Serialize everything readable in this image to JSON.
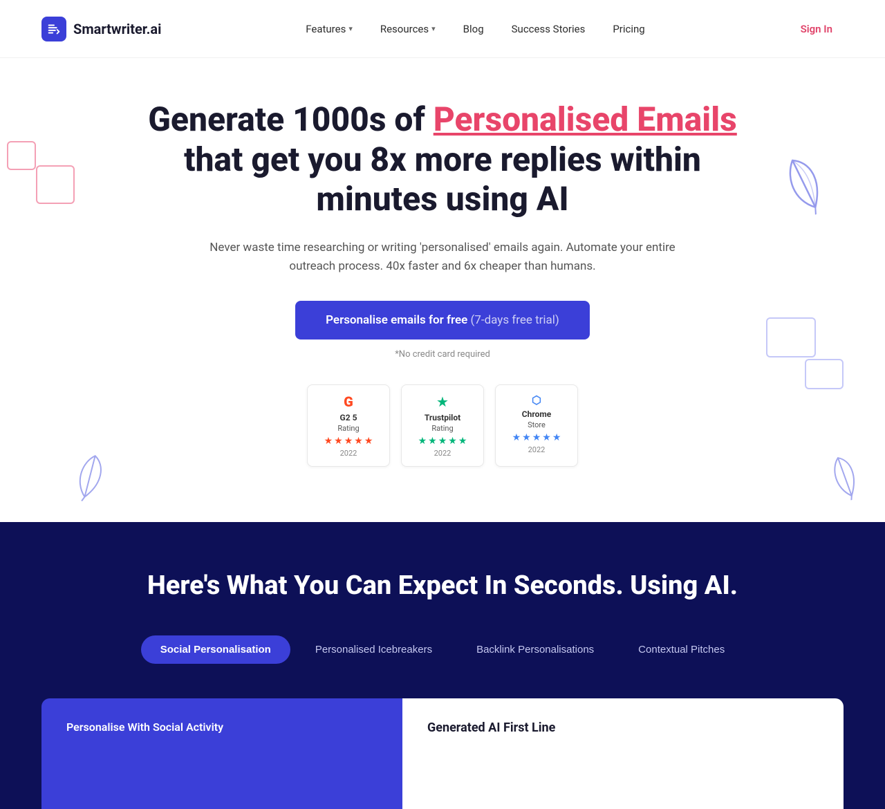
{
  "navbar": {
    "logo_text": "Smartwriter.ai",
    "nav_items": [
      {
        "label": "Features",
        "has_dropdown": true
      },
      {
        "label": "Resources",
        "has_dropdown": true
      },
      {
        "label": "Blog",
        "has_dropdown": false
      },
      {
        "label": "Success Stories",
        "has_dropdown": false
      },
      {
        "label": "Pricing",
        "has_dropdown": false
      }
    ],
    "signin_label": "Sign In"
  },
  "hero": {
    "title_before": "Generate 1000s of ",
    "title_highlight": "Personalised Emails",
    "title_after": " that get you 8x more replies within minutes using AI",
    "subtitle": "Never waste time researching or writing 'personalised' emails again. Automate your entire outreach process. 40x faster and 6x cheaper than humans.",
    "cta_label": "Personalise emails for free",
    "cta_trial": "(7-days free trial)",
    "no_cc_text": "*No credit card required",
    "ratings": [
      {
        "icon": "G",
        "icon_color": "#ff4921",
        "name": "G2 5",
        "label": "Rating",
        "year": "2022",
        "star_type": "g2"
      },
      {
        "icon": "★",
        "icon_color": "#00b67a",
        "name": "Trustpilot",
        "label": "Rating",
        "year": "2022",
        "star_type": "tp"
      },
      {
        "icon": "C",
        "icon_color": "#4285f4",
        "name": "Chrome",
        "label": "Store",
        "year": "2022",
        "star_type": "cs"
      }
    ]
  },
  "dark_section": {
    "title": "Here's What You Can Expect In Seconds. Using AI.",
    "tabs": [
      {
        "label": "Social Personalisation",
        "active": true
      },
      {
        "label": "Personalised Icebreakers",
        "active": false
      },
      {
        "label": "Backlink Personalisations",
        "active": false
      },
      {
        "label": "Contextual Pitches",
        "active": false
      }
    ],
    "preview_left_label": "Personalise With Social Activity",
    "preview_right_label": "Generated AI First Line"
  }
}
